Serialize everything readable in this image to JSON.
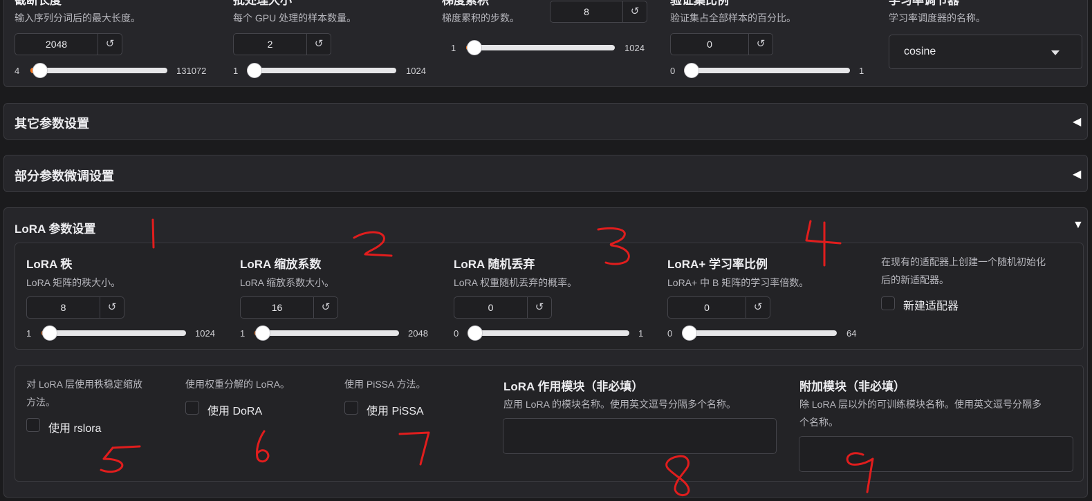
{
  "top_section": {
    "cutoff_len": {
      "title": "截断长度",
      "desc": "输入序列分词后的最大长度。",
      "value": "2048",
      "min": "4",
      "max": "131072",
      "fraction": 0.0156
    },
    "batch_size": {
      "title": "批处理大小",
      "desc": "每个 GPU 处理的样本数量。",
      "value": "2",
      "min": "1",
      "max": "1024",
      "fraction": 0.001
    },
    "grad_accum": {
      "title": "梯度累积",
      "desc": "梯度累积的步数。",
      "value": "8",
      "min": "1",
      "max": "1024",
      "fraction": 0.007
    },
    "val_size": {
      "title": "验证集比例",
      "desc": "验证集占全部样本的百分比。",
      "value": "0",
      "min": "0",
      "max": "1",
      "fraction": 0
    },
    "lr_scheduler": {
      "title": "学习率调节器",
      "desc": "学习率调度器的名称。",
      "value": "cosine"
    }
  },
  "reset_icon": "↺",
  "accordions": {
    "other": {
      "label": "其它参数设置",
      "arrow": "◀"
    },
    "freeze": {
      "label": "部分参数微调设置",
      "arrow": "◀"
    },
    "lora": {
      "label": "LoRA 参数设置",
      "arrow": "▼"
    }
  },
  "lora": {
    "rank": {
      "title": "LoRA 秩",
      "desc": "LoRA 矩阵的秩大小。",
      "value": "8",
      "min": "1",
      "max": "1024",
      "fraction": 0.007
    },
    "alpha": {
      "title": "LoRA 缩放系数",
      "desc": "LoRA 缩放系数大小。",
      "value": "16",
      "min": "1",
      "max": "2048",
      "fraction": 0.007
    },
    "dropout": {
      "title": "LoRA 随机丢弃",
      "desc": "LoRA 权重随机丢弃的概率。",
      "value": "0",
      "min": "0",
      "max": "1",
      "fraction": 0
    },
    "plus_ratio": {
      "title": "LoRA+ 学习率比例",
      "desc": "LoRA+ 中 B 矩阵的学习率倍数。",
      "value": "0",
      "min": "0",
      "max": "64",
      "fraction": 0
    },
    "create_new": {
      "desc_line1": "在现有的适配器上创建一个随机初始化",
      "desc_line2": "后的新适配器。",
      "label": "新建适配器"
    },
    "rslora": {
      "desc_line1": "对 LoRA 层使用秩稳定缩放",
      "desc_line2": "方法。",
      "label": "使用 rslora"
    },
    "dora": {
      "desc": "使用权重分解的 LoRA。",
      "label": "使用 DoRA"
    },
    "pissa": {
      "desc": "使用 PiSSA 方法。",
      "label": "使用 PiSSA"
    },
    "target": {
      "title": "LoRA 作用模块（非必填）",
      "desc": "应用 LoRA 的模块名称。使用英文逗号分隔多个名称。",
      "value": ""
    },
    "additional": {
      "title": "附加模块（非必填）",
      "desc_line1": "除 LoRA 层以外的可训练模块名称。使用英文逗号分隔多",
      "desc_line2": "个名称。",
      "value": ""
    }
  },
  "annotations": [
    "1",
    "2",
    "3",
    "4",
    "5",
    "6",
    "7",
    "8",
    "9"
  ],
  "colors": {
    "annotation": "#e11d1d",
    "slider_fill": "#f97316",
    "background": "#1b1b1d",
    "panel": "#26262a"
  }
}
